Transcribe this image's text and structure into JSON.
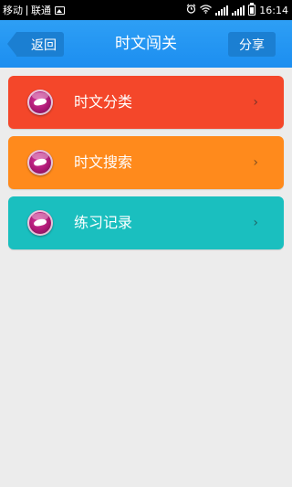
{
  "status_bar": {
    "carrier1": "移动",
    "carrier2": "联通",
    "time": "16:14",
    "background": "#000000"
  },
  "header": {
    "back_label": "返回",
    "title": "时文闯关",
    "share_label": "分享",
    "color": "#2196f3"
  },
  "menu": {
    "items": [
      {
        "label": "时文分类",
        "color": "#f4472a",
        "icon": "badge-icon",
        "chevron": "›"
      },
      {
        "label": "时文搜索",
        "color": "#ff8a1c",
        "icon": "badge-icon",
        "chevron": "›"
      },
      {
        "label": "练习记录",
        "color": "#1abfbf",
        "icon": "badge-icon",
        "chevron": "›"
      }
    ]
  }
}
